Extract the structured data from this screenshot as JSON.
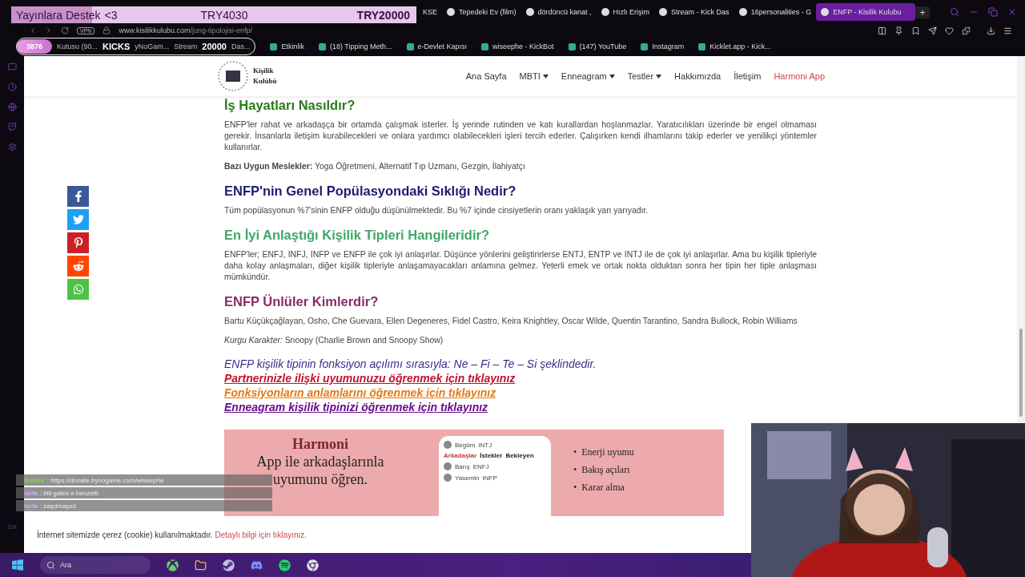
{
  "donation": {
    "label": "Yayınlara Destek",
    "heart": "<3",
    "current": "TRY4030",
    "goal": "TRY20000",
    "level": 0.2
  },
  "tabs": [
    {
      "label": "KSE",
      "selected": false
    },
    {
      "label": "Tepedeki Ev (film)",
      "selected": false
    },
    {
      "label": "dördüncü kanat ,",
      "selected": false
    },
    {
      "label": "Hızlı Erişim",
      "selected": false
    },
    {
      "label": "Stream - Kick Das",
      "selected": false
    },
    {
      "label": "16personalities - G",
      "selected": false
    },
    {
      "label": "ENFP - Kisilik Kulubu",
      "selected": true
    }
  ],
  "new_tab": "+",
  "address": {
    "vpn": "VPN",
    "host": "www.kisilikkulubu.com",
    "path": "/jung-tipolojisi-enfp/"
  },
  "stream_counter": {
    "count": "3876",
    "kicks": "KICKS",
    "goal": "20000",
    "hidden_bookmarks": [
      "Kutusu (90...",
      "yNoGam...",
      "Stream",
      "Das..."
    ]
  },
  "bookmarks": [
    "Etkinlik",
    "(18) Tipping Meth...",
    "e-Devlet Kapısı",
    "wiseephe - KickBot",
    "(147) YouTube",
    "Instagram",
    "Kicklet.app - Kick..."
  ],
  "site_nav": {
    "logo": [
      "Kişilik",
      "Kulübü"
    ],
    "items": [
      {
        "label": "Ana Sayfa",
        "has_menu": false,
        "highlight": false
      },
      {
        "label": "MBTI",
        "has_menu": true,
        "highlight": false
      },
      {
        "label": "Enneagram",
        "has_menu": true,
        "highlight": false
      },
      {
        "label": "Testler",
        "has_menu": true,
        "highlight": false
      },
      {
        "label": "Hakkımızda",
        "has_menu": false,
        "highlight": false
      },
      {
        "label": "İletişim",
        "has_menu": false,
        "highlight": false
      },
      {
        "label": "Harmoni App",
        "has_menu": false,
        "highlight": true
      }
    ]
  },
  "sections": [
    {
      "heading": "İş Hayatları Nasıldır?",
      "color": "#2b7a1c",
      "paragraphs": [
        "ENFP'ler rahat ve arkadaşça bir ortamda çalışmak isterler. İş yerinde rutinden ve katı kurallardan hoşlanmazlar. Yaratıcılıkları üzerinde bir engel olmaması gerekir. İnsanlarla iletişim kurabilecekleri ve onlara yardımcı olabilecekleri işleri tercih ederler. Çalışırken kendi ilhamlarını takip ederler ve yenilikçi yöntemler kullanırlar.",
        "**Bazı Uygun Meslekler:** Yoga Öğretmeni, Alternatif Tıp Uzmanı, Gezgin, İlahiyatçı"
      ]
    },
    {
      "heading": "ENFP'nin Genel Popülasyondaki Sıklığı Nedir?",
      "color": "#1c1c6e",
      "paragraphs": [
        "Tüm popülasyonun %7'sinin ENFP olduğu düşünülmektedir. Bu %7 içinde cinsiyetlerin oranı yaklaşık yarı yarıyadır."
      ]
    },
    {
      "heading": "En İyi Anlaştığı Kişilik Tipleri Hangileridir?",
      "color": "#3fa866",
      "paragraphs": [
        "ENFP'ler; ENFJ, INFJ, INFP ve ENFP ile çok iyi anlaşırlar. Düşünce yönlerini geliştirirlerse ENTJ, ENTP ve INTJ ile de çok iyi anlaşırlar. Ama bu kişilik tipleriyle daha kolay anlaşmaları, diğer kişilik tipleriyle anlaşamayacakları anlamına gelmez. Yeterli emek ve ortak nokta olduktan sonra her tipin her tiple anlaşması mümkündür."
      ]
    },
    {
      "heading": "ENFP Ünlüler Kimlerdir?",
      "color": "#8a2a6a",
      "paragraphs": [
        "Bartu Küçükçağlayan, Osho, Che Guevara, Ellen Degeneres, Fidel Castro, Keira Knightley, Oscar Wilde, Quentin Tarantino, Sandra Bullock, Robin Williams",
        "*Kurgu Karakter:* Snoopy (Charlie Brown and Snoopy Show)"
      ]
    }
  ],
  "function_line": "ENFP kişilik tipinin fonksiyon açılımı sırasıyla: Ne – Fi – Te – Si şeklindedir.",
  "links": [
    {
      "label": "Partnerinizle ilişki uyumunuzu öğrenmek için tıklayınız",
      "color": "#c4122c"
    },
    {
      "label": "Fonksiyonların anlamlarını öğrenmek için tıklayınız",
      "color": "#e27a12"
    },
    {
      "label": "Enneagram kişilik tipinizi öğrenmek için tıklayınız",
      "color": "#6a0c8c"
    }
  ],
  "banner": {
    "title": "Harmoni",
    "subtitle": [
      "App ile arkadaşlarınla",
      "uyumunu öğren."
    ],
    "phone": {
      "profile": [
        "Begüm",
        "INTJ"
      ],
      "tabs": [
        "Arkadaşlar",
        "İstekler",
        "Bekleyen"
      ],
      "friends": [
        [
          "Barış",
          "ENFJ"
        ],
        [
          "Yasemin",
          "INFP"
        ]
      ]
    },
    "marker": "•",
    "bullets": [
      "Enerji uyumu",
      "Bakış açıları",
      "Karar alma"
    ]
  },
  "chat": [
    {
      "user": "BotRix",
      "message": ": https://donate.bynogame.com/wiseephe",
      "color": "#7ddc3a"
    },
    {
      "user": "isrfa",
      "message": ": bill gates e benzetti",
      "color": "#c8b4ff"
    },
    {
      "user": "isrfa",
      "message": ": saşdmaşsd",
      "color": "#c8b4ff"
    }
  ],
  "cookie": {
    "text": "İnternet sitemizde çerez (cookie) kullanılmaktadır.",
    "link": "Detaylı bilgi için tıklayınız."
  },
  "sidebar_label": "GX",
  "taskbar": {
    "search": "Ara"
  }
}
